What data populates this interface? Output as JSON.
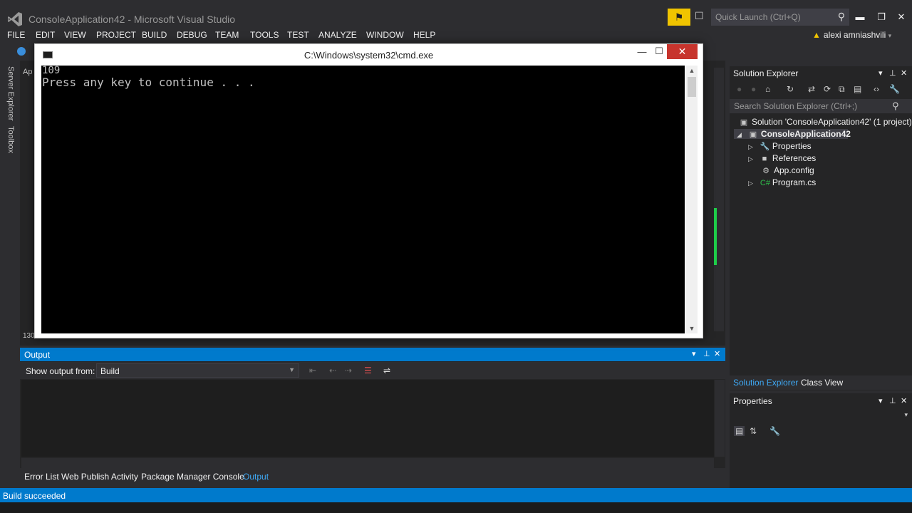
{
  "window": {
    "title": "ConsoleApplication42 - Microsoft Visual Studio",
    "quick_launch_placeholder": "Quick Launch (Ctrl+Q)",
    "user_name": "alexi amniashvili"
  },
  "menu": [
    "FILE",
    "EDIT",
    "VIEW",
    "PROJECT",
    "BUILD",
    "DEBUG",
    "TEAM",
    "TOOLS",
    "TEST",
    "ANALYZE",
    "WINDOW",
    "HELP"
  ],
  "siderail": {
    "server_explorer": "Server Explorer",
    "toolbox": "Toolbox"
  },
  "editor": {
    "tab_stub": "Ap",
    "line_stub": "130"
  },
  "cmd": {
    "title": "C:\\Windows\\system32\\cmd.exe",
    "lines": [
      "109",
      "Press any key to continue . . ."
    ]
  },
  "solution_explorer": {
    "title": "Solution Explorer",
    "search_placeholder": "Search Solution Explorer (Ctrl+;)",
    "tree": {
      "solution": "Solution 'ConsoleApplication42' (1 project)",
      "project": "ConsoleApplication42",
      "items": [
        "Properties",
        "References",
        "App.config",
        "Program.cs"
      ]
    },
    "tabs": [
      "Solution Explorer",
      "Class View"
    ]
  },
  "properties": {
    "title": "Properties"
  },
  "output": {
    "title": "Output",
    "show_from_label": "Show output from:",
    "selected_source": "Build"
  },
  "bottom_tabs": [
    "Error List",
    "Web Publish Activity",
    "Package Manager Console",
    "Output"
  ],
  "status": {
    "text": "Build succeeded"
  },
  "colors": {
    "accent": "#007acc",
    "cmd_close": "#c7342d",
    "notify": "#f0c400",
    "selection_marker": "#1fcf4a"
  }
}
